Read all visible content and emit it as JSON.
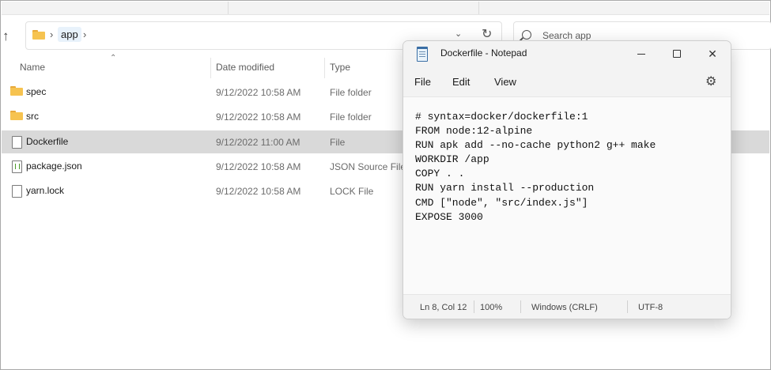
{
  "explorer": {
    "address": {
      "folder": "app"
    },
    "search": {
      "placeholder": "Search app"
    },
    "columns": {
      "name": "Name",
      "date": "Date modified",
      "type": "Type"
    },
    "files": [
      {
        "name": "spec",
        "date": "9/12/2022 10:58 AM",
        "type": "File folder",
        "icon": "folder-icon"
      },
      {
        "name": "src",
        "date": "9/12/2022 10:58 AM",
        "type": "File folder",
        "icon": "folder-icon"
      },
      {
        "name": "Dockerfile",
        "date": "9/12/2022 11:00 AM",
        "type": "File",
        "icon": "file-icon",
        "selected": true
      },
      {
        "name": "package.json",
        "date": "9/12/2022 10:58 AM",
        "type": "JSON Source File",
        "icon": "json-file-icon"
      },
      {
        "name": "yarn.lock",
        "date": "9/12/2022 10:58 AM",
        "type": "LOCK File",
        "icon": "file-icon"
      }
    ]
  },
  "notepad": {
    "title": "Dockerfile - Notepad",
    "menu": {
      "file": "File",
      "edit": "Edit",
      "view": "View"
    },
    "content": "# syntax=docker/dockerfile:1\nFROM node:12-alpine\nRUN apk add --no-cache python2 g++ make\nWORKDIR /app\nCOPY . .\nRUN yarn install --production\nCMD [\"node\", \"src/index.js\"]\nEXPOSE 3000",
    "status": {
      "position": "Ln 8, Col 12",
      "zoom": "100%",
      "line_ending": "Windows (CRLF)",
      "encoding": "UTF-8"
    }
  },
  "colors": {
    "selected_row": "#d9d9d9",
    "folder": "#f6c350",
    "accent": "#3a6ea5"
  }
}
